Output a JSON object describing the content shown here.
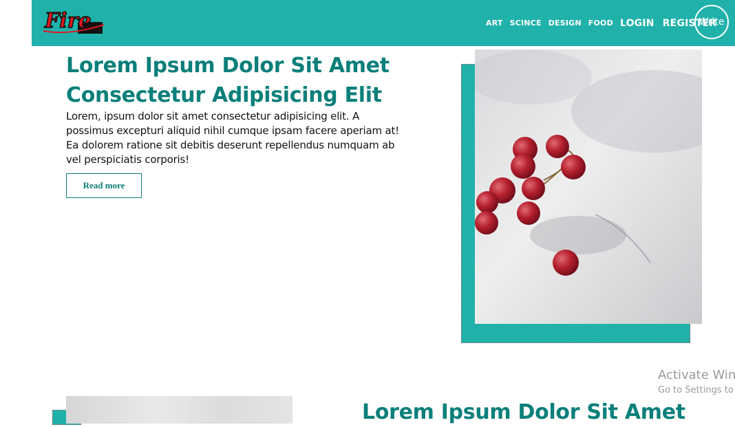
{
  "navbar": {
    "logo_text": "Fire",
    "links": [
      "ART",
      "SCINCE",
      "DESIGN",
      "FOOD"
    ],
    "login": "LOGIN",
    "register": "REGISTER",
    "write": "Write",
    "color": "#20b2aa"
  },
  "post1": {
    "title": "Lorem Ipsum Dolor Sit Amet Consectetur Adipisicing Elit",
    "body": "Lorem, ipsum dolor sit amet consectetur adipisicing elit. A possimus excepturi aliquid nihil cumque ipsam facere aperiam at! Ea dolorem ratione sit debitis deserunt repellendus numquam ab vel perspiciatis corporis!",
    "button": "Read more",
    "image": "grapes-photo"
  },
  "post2": {
    "title": "Lorem Ipsum Dolor Sit Amet",
    "image": "gray-photo"
  },
  "watermark": {
    "title": "Activate Windows",
    "subtitle": "Go to Settings to activate Windows."
  },
  "colors": {
    "accent": "#20b2aa",
    "heading": "#0b7f7a"
  }
}
